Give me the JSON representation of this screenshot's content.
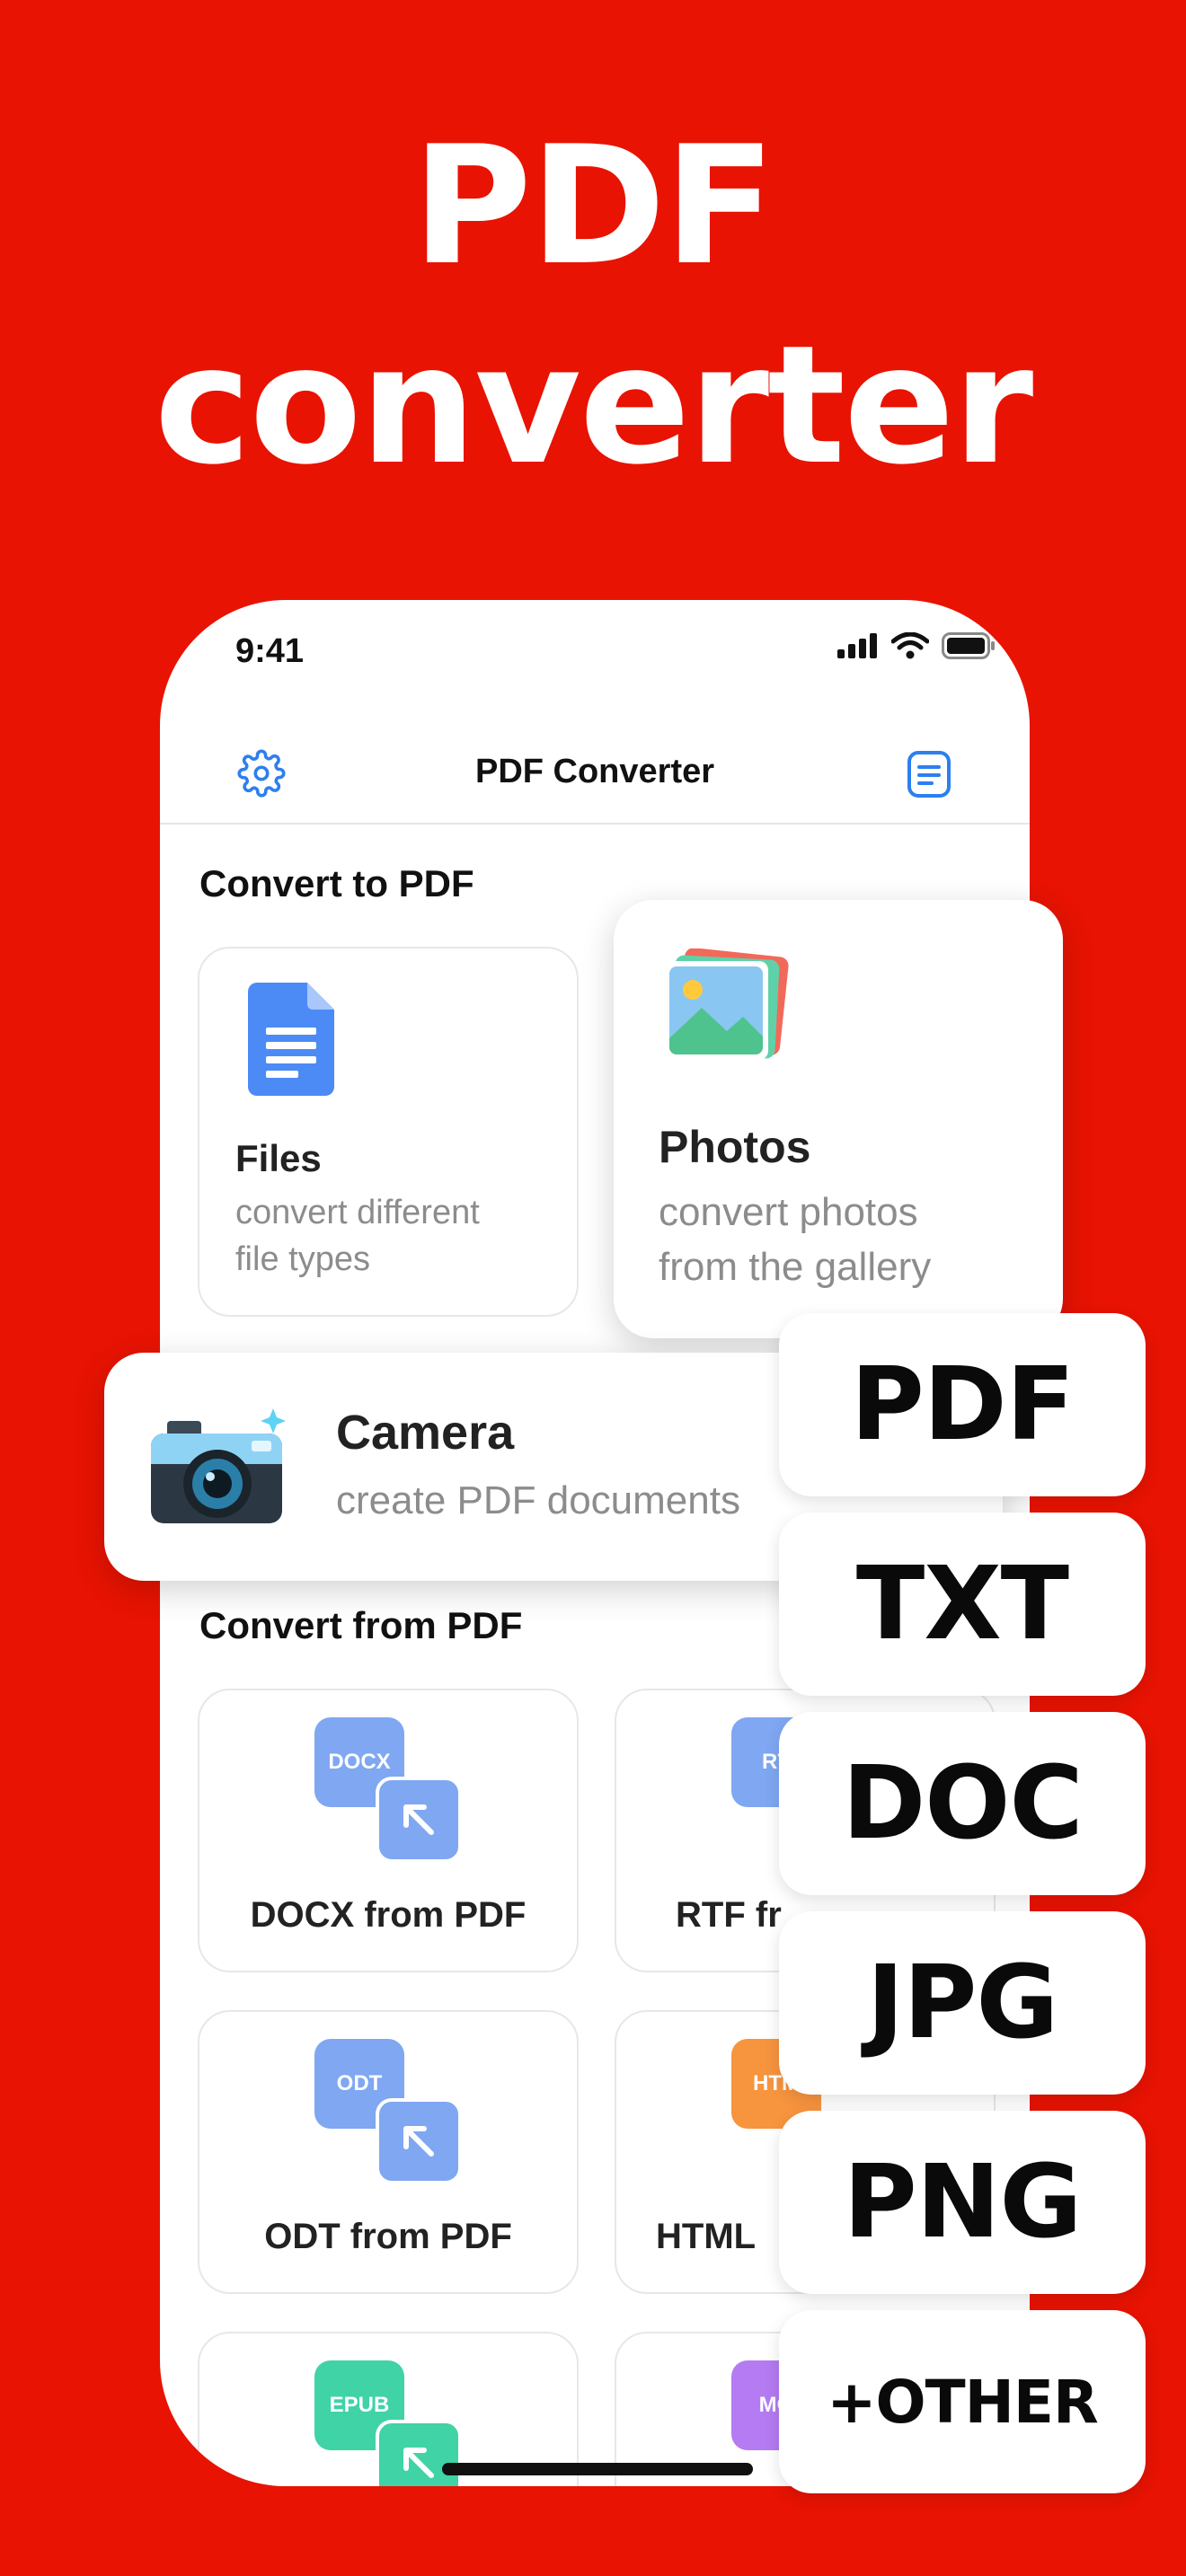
{
  "headline": {
    "line1": "PDF",
    "line2": "converter"
  },
  "status_bar": {
    "time": "9:41"
  },
  "nav": {
    "title": "PDF Converter",
    "left_icon": "gear-icon",
    "right_icon": "document-list-icon"
  },
  "convert_to": {
    "section_title": "Convert to PDF",
    "files": {
      "title": "Files",
      "subtitle_line1": "convert different",
      "subtitle_line2": "file types"
    },
    "photos": {
      "title": "Photos",
      "subtitle_line1": "convert photos",
      "subtitle_line2": "from the gallery"
    },
    "camera": {
      "title": "Camera",
      "subtitle": "create PDF documents"
    }
  },
  "convert_from": {
    "section_title": "Convert from PDF",
    "tiles": [
      {
        "badge": "DOCX",
        "label": "DOCX from PDF",
        "color": "#7FA7F2"
      },
      {
        "badge": "RT",
        "label": "RTF fr",
        "color": "#7FA7F2"
      },
      {
        "badge": "ODT",
        "label": "ODT from PDF",
        "color": "#7FA7F2"
      },
      {
        "badge": "HTM",
        "label": "HTML",
        "color": "#F7943E"
      },
      {
        "badge": "EPUB",
        "label": "",
        "color": "#3FD3A6"
      },
      {
        "badge": "MO",
        "label": "",
        "color": "#B57BF2"
      }
    ]
  },
  "formats": [
    "PDF",
    "TXT",
    "DOC",
    "JPG",
    "PNG",
    "+OTHER"
  ],
  "colors": {
    "background": "#E81302",
    "accent_blue": "#2D7FF0"
  }
}
